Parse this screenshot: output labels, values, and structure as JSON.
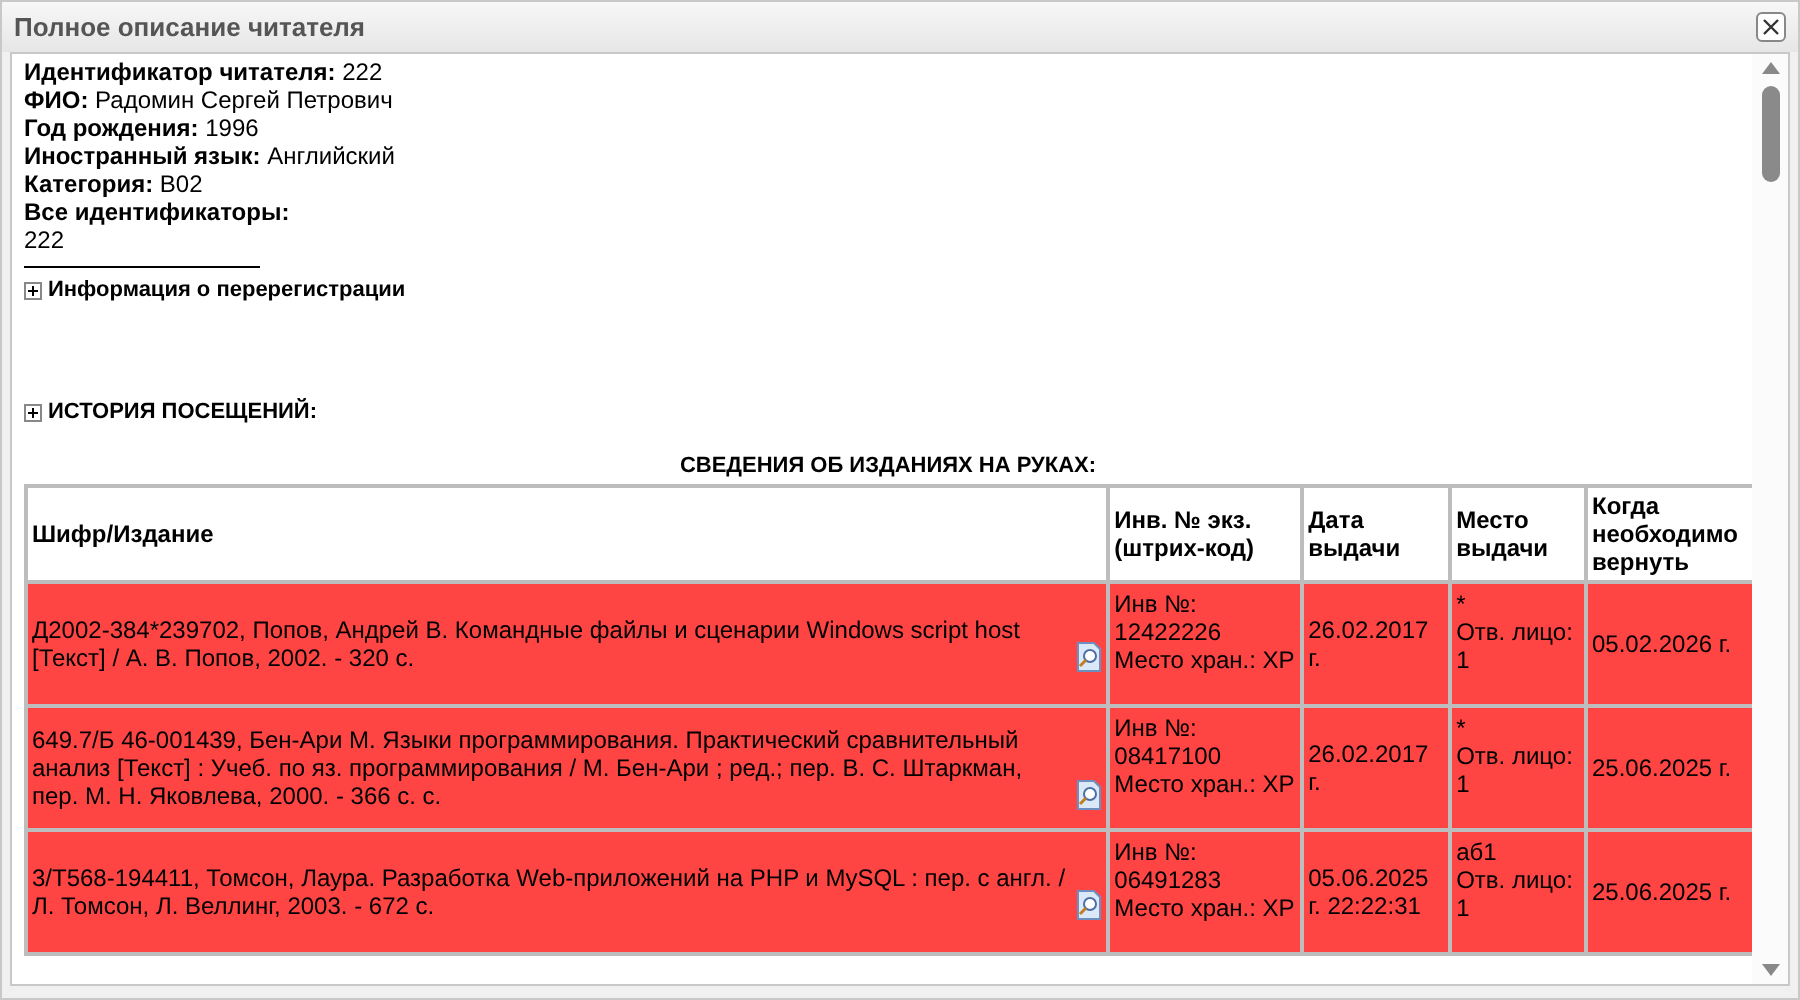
{
  "window": {
    "title": "Полное описание читателя"
  },
  "reader_info": [
    "**Идентификатор читателя:** 222",
    "**ФИО:** Радомин Сергей Петрович",
    "**Год рождения:** 1996",
    "**Иностранный язык:** Английский",
    "**Категория:** В02",
    "**Все идентификаторы:**",
    "222"
  ],
  "sections": [
    {
      "label": "Информация о перерегистрации",
      "expanded": false
    },
    {
      "label": "ИСТОРИЯ ПОСЕЩЕНИЙ:",
      "expanded": false
    }
  ],
  "loans": {
    "title": "СВЕДЕНИЯ ОБ ИЗДАНИЯХ НА РУКАХ:",
    "columns": [
      "Шифр/Издание",
      "Инв. № экз. (штрих-код)",
      "Дата выдачи",
      "Место выдачи",
      "Когда необходимо вернуть"
    ],
    "rows": [
      {
        "edition": "Д2002-384*239702, Попов, Андрей В. Командные файлы и сценарии Windows script host [Текст] / А. В. Попов, 2002. - 320 с.",
        "inventory": "Инв №: 12422226",
        "storage": "Место хран.: ХР",
        "issued": "26.02.2017 г.",
        "place": "*",
        "responsible": "Отв. лицо: 1",
        "due": "05.02.2026 г.",
        "overdue": true
      },
      {
        "edition": "649.7/Б 46-001439, Бен-Ари М. Языки программирования. Практический сравнительный анализ [Текст] : Учеб. по яз. программирования / М. Бен-Ари ; ред.; пер. В. С. Штаркман, пер. М. Н. Яковлева, 2000. - 366 с. с.",
        "inventory": "Инв №: 08417100",
        "storage": "Место хран.: ХР",
        "issued": "26.02.2017 г.",
        "place": "*",
        "responsible": "Отв. лицо: 1",
        "due": "25.06.2025 г.",
        "overdue": true
      },
      {
        "edition": "3/Т568-194411, Томсон, Лаура. Разработка Web-приложений на PHP и MySQL : пер. с англ. / Л. Томсон, Л. Веллинг, 2003. - 672 с.",
        "inventory": "Инв №: 06491283",
        "storage": "Место хран.: ХР",
        "issued": "05.06.2025 г. 22:22:31",
        "place": "аб1",
        "responsible": "Отв. лицо: 1",
        "due": "25.06.2025 г.",
        "overdue": true
      }
    ]
  }
}
